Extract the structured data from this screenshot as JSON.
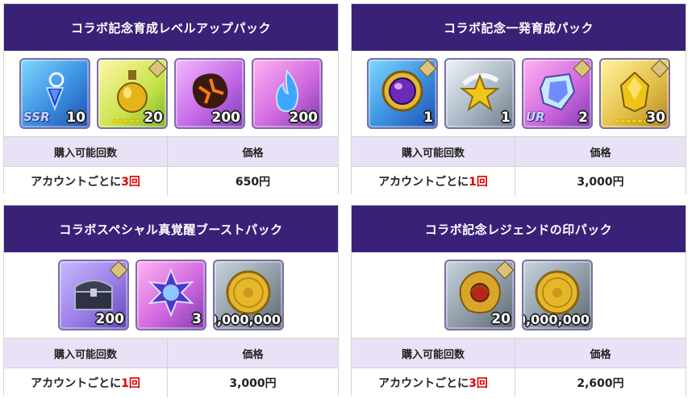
{
  "packs": [
    {
      "title": "コラボ記念育成レベルアップパック",
      "items": [
        {
          "icon": "blue-gem-pendant-icon",
          "quantity": "10",
          "rank": "SSR"
        },
        {
          "icon": "golden-potion-icon",
          "quantity": "20",
          "stars": "★★★★★"
        },
        {
          "icon": "lava-rock-icon",
          "quantity": "200"
        },
        {
          "icon": "blue-flame-icon",
          "quantity": "200"
        }
      ],
      "table": {
        "limit_header": "購入可能回数",
        "price_header": "価格",
        "limit_prefix": "アカウントごとに",
        "limit_number": "3",
        "limit_suffix": "回",
        "price": "650円"
      }
    },
    {
      "title": "コラボ記念一発育成パック",
      "items": [
        {
          "icon": "purple-orb-ring-icon",
          "quantity": "1"
        },
        {
          "icon": "gold-star-emblem-icon",
          "quantity": "1"
        },
        {
          "icon": "crystal-armor-icon",
          "quantity": "2",
          "rank": "UR"
        },
        {
          "icon": "gold-crystal-icon",
          "quantity": "30",
          "stars": "★★★★★★"
        }
      ],
      "table": {
        "limit_header": "購入可能回数",
        "price_header": "価格",
        "limit_prefix": "アカウントごとに",
        "limit_number": "1",
        "limit_suffix": "回",
        "price": "3,000円"
      }
    },
    {
      "title": "コラボスペシャル真覚醒ブーストパック",
      "items": [
        {
          "icon": "treasure-chest-icon",
          "quantity": "200"
        },
        {
          "icon": "star-crystal-icon",
          "quantity": "3"
        },
        {
          "icon": "gold-coin-icon",
          "quantity": "10,000,000"
        }
      ],
      "table": {
        "limit_header": "購入可能回数",
        "price_header": "価格",
        "limit_prefix": "アカウントごとに",
        "limit_number": "1",
        "limit_suffix": "回",
        "price": "3,000円"
      }
    },
    {
      "title": "コラボ記念レジェンドの印パック",
      "items": [
        {
          "icon": "legend-seal-icon",
          "quantity": "20"
        },
        {
          "icon": "gold-coin-icon",
          "quantity": "20,000,000"
        }
      ],
      "table": {
        "limit_header": "購入可能回数",
        "price_header": "価格",
        "limit_prefix": "アカウントごとに",
        "limit_number": "3",
        "limit_suffix": "回",
        "price": "2,600円"
      }
    }
  ],
  "colors": {
    "header_bg": "#3a2178",
    "table_head_bg": "#e9e2f7",
    "limit_highlight": "#e00000"
  }
}
